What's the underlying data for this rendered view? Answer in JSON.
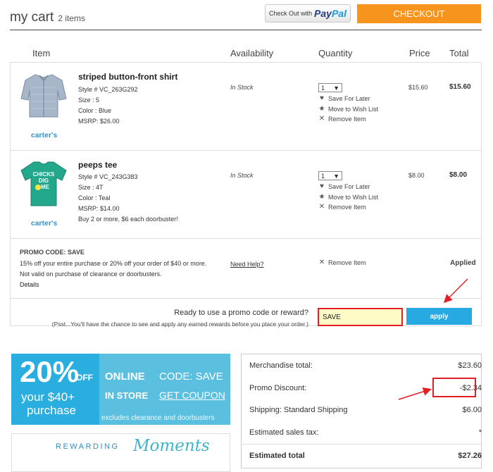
{
  "header": {
    "title": "my cart",
    "item_count": "2 items",
    "paypal_prefix": "Check Out with",
    "paypal_pay": "Pay",
    "paypal_pal": "Pal",
    "checkout_label": "CHECKOUT"
  },
  "columns": {
    "item": "Item",
    "availability": "Availability",
    "quantity": "Quantity",
    "price": "Price",
    "total": "Total"
  },
  "products": [
    {
      "name": "striped button-front shirt",
      "style": "Style # VC_263G292",
      "size": "Size : 5",
      "color": "Color : Blue",
      "msrp": "MSRP: $26.00",
      "note": "",
      "brand": "carter's",
      "availability": "In Stock",
      "qty": "1",
      "price": "$15.60",
      "total": "$15.60"
    },
    {
      "name": "peeps tee",
      "style": "Style # VC_243G383",
      "size": "Size : 4T",
      "color": "Color : Teal",
      "msrp": "MSRP: $14.00",
      "note": "Buy 2 or more, $6 each doorbuster!",
      "brand": "carter's",
      "availability": "In Stock",
      "qty": "1",
      "price": "$8.00",
      "total": "$8.00"
    }
  ],
  "actions": {
    "save_later": "Save For Later",
    "wish_list": "Move to Wish List",
    "remove": "Remove Item"
  },
  "promo": {
    "title": "PROMO CODE: SAVE",
    "line1": "15% off your entire purchase or 20% off your order of $40 or more.",
    "line2": "Not valid on purchase of clearance or doorbusters.",
    "details": "Details",
    "need_help": "Need Help?",
    "remove": "Remove Item",
    "status": "Applied",
    "ask": "Ready to use a promo code or reward?",
    "psst": "(Psst...You'll have the chance to see and apply any earned rewards before you place your order.)",
    "input_value": "SAVE",
    "apply_label": "apply"
  },
  "banner": {
    "percent": "20%",
    "off": "OFF",
    "your": "your $40+",
    "purchase": "purchase",
    "online": "ONLINE",
    "code": "CODE: SAVE",
    "instore": "IN STORE",
    "coupon": "GET COUPON",
    "excludes": "excludes clearance and doorbusters"
  },
  "rewards": {
    "rewarding": "REWARDING",
    "moments": "Moments"
  },
  "summary": {
    "merch_label": "Merchandise total:",
    "merch_value": "$23.60",
    "promo_label": "Promo Discount:",
    "promo_value": "-$2.34",
    "ship_label": "Shipping: Standard Shipping",
    "ship_value": "$6.00",
    "tax_label": "Estimated sales tax:",
    "tax_value": "*",
    "total_label": "Estimated total",
    "total_value": "$27.26"
  },
  "colors": {
    "checkout": "#f7941d",
    "apply": "#27a9e1",
    "annotation": "#e31e24",
    "banner": "#5bc0e0"
  }
}
